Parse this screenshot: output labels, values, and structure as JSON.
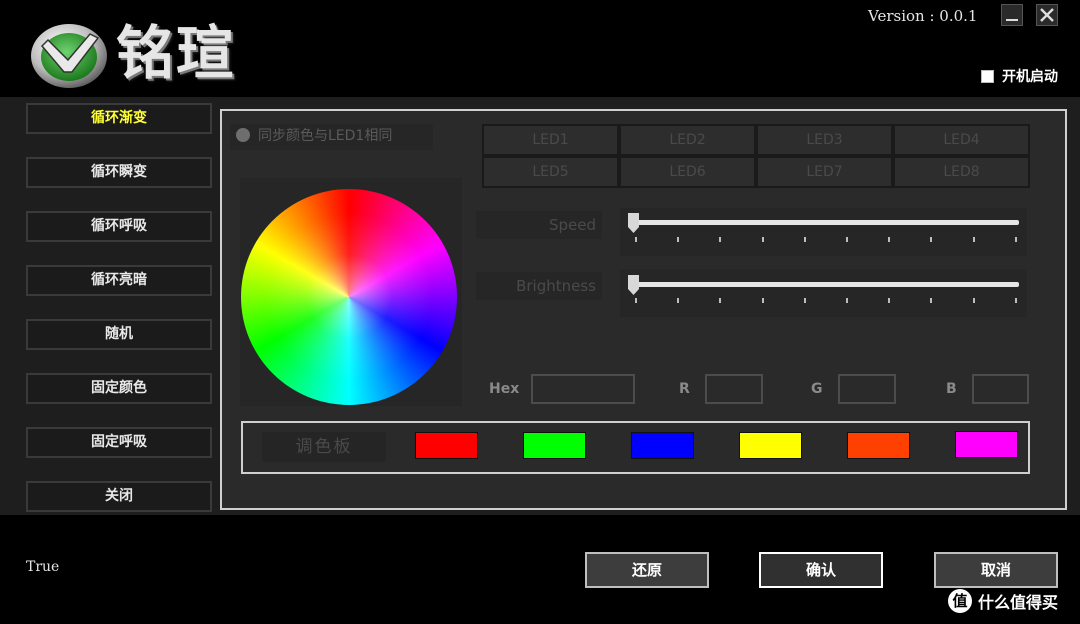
{
  "header": {
    "brand_name": "铭瑄",
    "version": "Version : 0.0.1",
    "minimize_icon": "minimize-icon",
    "close_icon": "close-icon",
    "startup_label": "开机启动",
    "startup_checked": false
  },
  "sidebar": {
    "items": [
      {
        "label": "循环渐变",
        "active": true
      },
      {
        "label": "循环瞬变",
        "active": false
      },
      {
        "label": "循环呼吸",
        "active": false
      },
      {
        "label": "循环亮暗",
        "active": false
      },
      {
        "label": "随机",
        "active": false
      },
      {
        "label": "固定颜色",
        "active": false
      },
      {
        "label": "固定呼吸",
        "active": false
      },
      {
        "label": "关闭",
        "active": false
      }
    ]
  },
  "main": {
    "sync_label": "同步颜色与LED1相同",
    "leds": [
      "LED1",
      "LED2",
      "LED3",
      "LED4",
      "LED5",
      "LED6",
      "LED7",
      "LED8"
    ],
    "speed_label": "Speed",
    "brightness_label": "Brightness",
    "speed_value": 0,
    "brightness_value": 0,
    "hex_label": "Hex",
    "r_label": "R",
    "g_label": "G",
    "b_label": "B",
    "hex_value": "",
    "r_value": "",
    "g_value": "",
    "b_value": "",
    "palette_label": "调色板",
    "palette_colors": [
      "#ff0000",
      "#00ff00",
      "#0000ff",
      "#ffff00",
      "#ff4000",
      "#ff00ff"
    ]
  },
  "footer": {
    "status_text": "True",
    "restore_label": "还原",
    "ok_label": "确认",
    "cancel_label": "取消"
  },
  "watermark": {
    "icon_text": "值",
    "text": "什么值得买"
  }
}
